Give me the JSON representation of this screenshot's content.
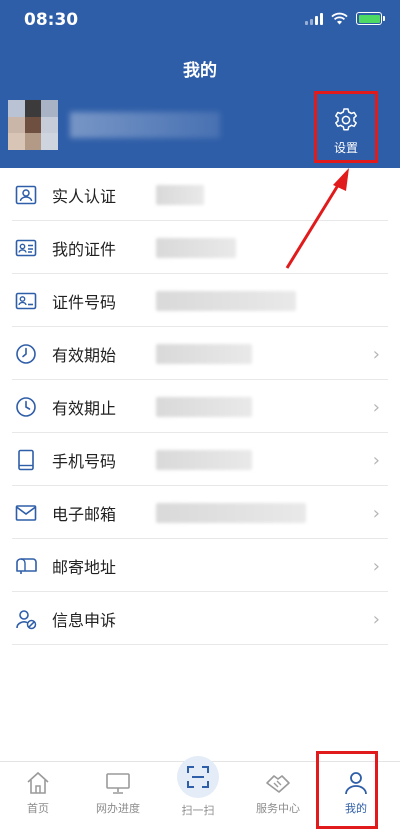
{
  "status_bar": {
    "time": "08:30"
  },
  "header": {
    "title": "我的",
    "settings_label": "设置",
    "settings_icon": "gear-icon"
  },
  "list": {
    "items": [
      {
        "label": "实人认证",
        "icon": "id-card-icon",
        "value_blur_width": 48,
        "has_arrow": false
      },
      {
        "label": "我的证件",
        "icon": "id-document-icon",
        "value_blur_width": 80,
        "has_arrow": false
      },
      {
        "label": "证件号码",
        "icon": "card-number-icon",
        "value_blur_width": 140,
        "has_arrow": false
      },
      {
        "label": "有效期始",
        "icon": "clock-icon",
        "value_blur_width": 96,
        "has_arrow": true
      },
      {
        "label": "有效期止",
        "icon": "clock-icon",
        "value_blur_width": 96,
        "has_arrow": true
      },
      {
        "label": "手机号码",
        "icon": "phone-icon",
        "value_blur_width": 96,
        "has_arrow": true
      },
      {
        "label": "电子邮箱",
        "icon": "mail-icon",
        "value_blur_width": 150,
        "has_arrow": true
      },
      {
        "label": "邮寄地址",
        "icon": "mailbox-icon",
        "value_blur_width": 0,
        "has_arrow": true
      },
      {
        "label": "信息申诉",
        "icon": "user-report-icon",
        "value_blur_width": 0,
        "has_arrow": true
      }
    ]
  },
  "tabbar": {
    "tabs": [
      {
        "label": "首页",
        "icon": "home-icon"
      },
      {
        "label": "网办进度",
        "icon": "monitor-icon"
      },
      {
        "label": "扫一扫",
        "icon": "scan-icon"
      },
      {
        "label": "服务中心",
        "icon": "handshake-icon"
      },
      {
        "label": "我的",
        "icon": "user-icon"
      }
    ],
    "active_index": 4
  },
  "colors": {
    "header_bg": "#2f5ea8",
    "annotation_red": "#e11b1b",
    "icon_blue": "#2f5ea8"
  }
}
